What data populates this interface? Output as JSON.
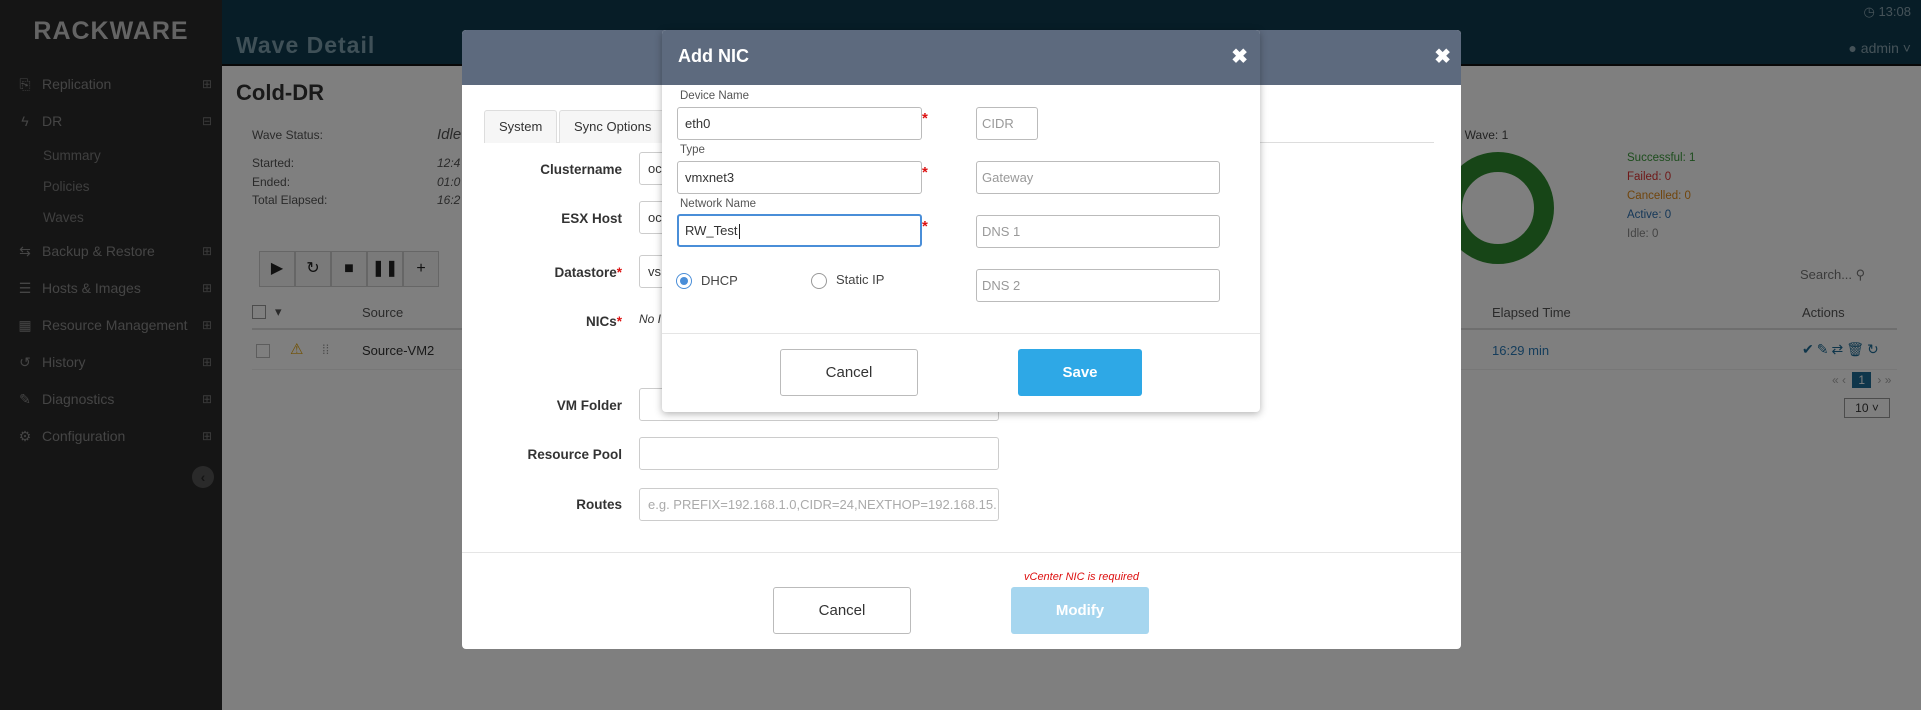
{
  "app": {
    "logo": "RACKWARE",
    "page_title": "Wave Detail",
    "clock": "13:08",
    "user": "admin"
  },
  "sidebar": {
    "items": [
      {
        "label": "Replication",
        "icon": "replication-icon",
        "expander": "⊞"
      },
      {
        "label": "DR",
        "icon": "bolt-icon",
        "expander": "⊟"
      },
      {
        "label": "Backup & Restore",
        "icon": "backup-icon",
        "expander": "⊞"
      },
      {
        "label": "Hosts & Images",
        "icon": "hosts-icon",
        "expander": "⊞"
      },
      {
        "label": "Resource Management",
        "icon": "table-icon",
        "expander": "⊞"
      },
      {
        "label": "History",
        "icon": "history-icon",
        "expander": "⊞"
      },
      {
        "label": "Diagnostics",
        "icon": "wrench-icon",
        "expander": "⊞"
      },
      {
        "label": "Configuration",
        "icon": "gears-icon",
        "expander": "⊞"
      }
    ],
    "dr_subitems": [
      "Summary",
      "Policies",
      "Waves"
    ]
  },
  "page": {
    "heading": "Cold-DR",
    "wave_status_label": "Wave Status:",
    "wave_status_value": "Idle",
    "started_label": "Started:",
    "started_value": "12:4",
    "ended_label": "Ended:",
    "ended_value": "01:0",
    "elapsed_label": "Total Elapsed:",
    "elapsed_value": "16:2",
    "hosts_in_wave": "s In Wave: 1",
    "legend": [
      {
        "label": "Successful:",
        "value": "1",
        "color": "#3a9a3a"
      },
      {
        "label": "Failed:",
        "value": "0",
        "color": "#d33"
      },
      {
        "label": "Cancelled:",
        "value": "0",
        "color": "#e08a1a"
      },
      {
        "label": "Active:",
        "value": "0",
        "color": "#2a6fb0"
      },
      {
        "label": "Idle:",
        "value": "0",
        "color": "#888"
      }
    ],
    "search_placeholder": "Search...",
    "table": {
      "col_source": "Source",
      "col_elapsed": "Elapsed Time",
      "col_actions": "Actions",
      "row_source": "Source-VM2",
      "row_elapsed": "16:29 min"
    },
    "pager_current": "1",
    "page_size": "10"
  },
  "outer_modal": {
    "tabs": [
      "System",
      "Sync Options"
    ],
    "fields": {
      "clustername_label": "Clustername",
      "clustername_value": "oc",
      "esx_label": "ESX Host",
      "esx_value": "oc",
      "datastore_label": "Datastore",
      "datastore_value": "vs",
      "nics_label": "NICs",
      "nics_value": "No I",
      "vmfolder_label": "VM Folder",
      "respool_label": "Resource Pool",
      "routes_label": "Routes",
      "routes_placeholder": "e.g. PREFIX=192.168.1.0,CIDR=24,NEXTHOP=192.168.15."
    },
    "error": "vCenter NIC is required",
    "cancel": "Cancel",
    "modify": "Modify"
  },
  "nic_modal": {
    "title": "Add NIC",
    "device_name_label": "Device Name",
    "device_name_value": "eth0",
    "type_label": "Type",
    "type_value": "vmxnet3",
    "network_name_label": "Network Name",
    "network_name_value": "RW_Test",
    "cidr_placeholder": "CIDR",
    "gateway_placeholder": "Gateway",
    "dns1_placeholder": "DNS 1",
    "dns2_placeholder": "DNS 2",
    "dhcp_label": "DHCP",
    "static_label": "Static IP",
    "ip_mode": "DHCP",
    "cancel": "Cancel",
    "save": "Save"
  }
}
